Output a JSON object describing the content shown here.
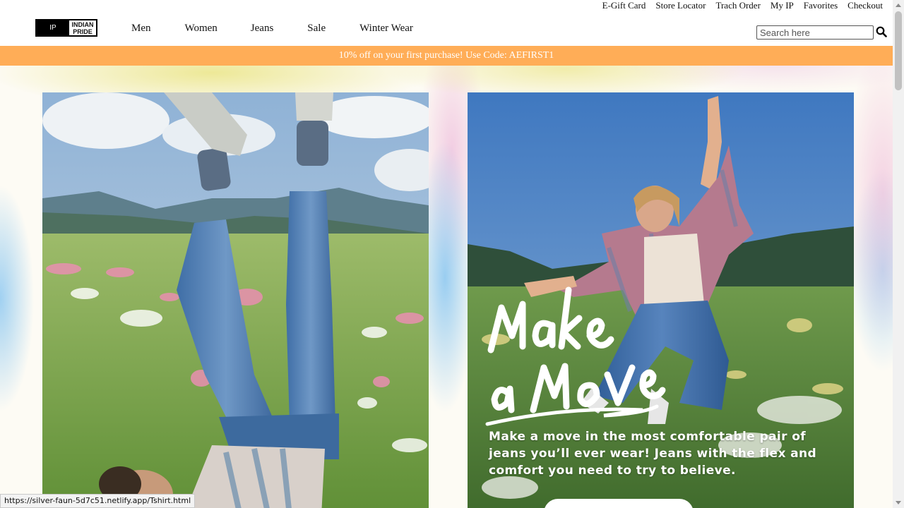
{
  "utility_links": [
    "E-Gift Card",
    "Store Locator",
    "Trach Order",
    "My IP",
    "Favorites",
    "Checkout"
  ],
  "logo": {
    "mark": "IP",
    "line1": "INDIAN",
    "line2": "PRIDE"
  },
  "nav": [
    "Men",
    "Women",
    "Jeans",
    "Sale",
    "Winter Wear"
  ],
  "search": {
    "placeholder": "Search here",
    "icon": "search-icon"
  },
  "promo_banner": {
    "text": "10% off on your first purchase! Use Code: AEFIRST1",
    "bg_color": "#ffad57"
  },
  "hero": {
    "right_headline": "Make a move",
    "right_body": "Make a move in the most comfortable pair of jeans you’ll ever wear! Jeans with the flex and comfort you need to try to believe."
  },
  "status_url": "https://silver-faun-5d7c51.netlify.app/Tshirt.html"
}
